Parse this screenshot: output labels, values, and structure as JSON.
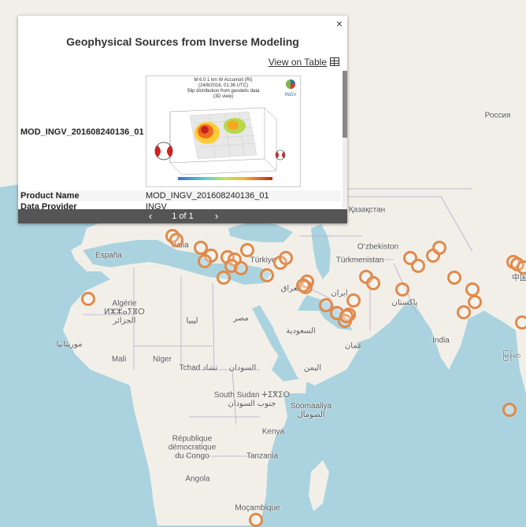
{
  "popup": {
    "title": "Geophysical Sources from Inverse Modeling",
    "close_label": "×",
    "view_table_label": "View on Table",
    "feature_id": "MOD_INGV_201608240136_01",
    "thumbnail": {
      "caption_lines": [
        "M 6.0 1 km W Accumoli (RI)",
        "(24/8/2016, 01:36 UTC)",
        "Slip distribution from geodetic data",
        "(3D view)"
      ],
      "brand": "INGV"
    },
    "attributes": [
      {
        "key": "Product Name",
        "value": "MOD_INGV_201608240136_01"
      },
      {
        "key": "Data Provider",
        "value": "INGV"
      }
    ],
    "pager": {
      "prev": "‹",
      "text": "1 of 1",
      "next": "›"
    }
  },
  "map_labels": {
    "russia": "Россия",
    "kazakhstan": "Қазақстан",
    "uzbekistan": "O‘zbekiston",
    "turkmenistan": "Türkmenistan",
    "turkey": "Türkiye",
    "italy": "Italia",
    "spain": "España",
    "algeria": "Algérie\nⵍⵣⵣⴰⵢⴻⵔ\nالجزائر",
    "morocco": "موريتانيا",
    "libya": "ليبيا",
    "egypt": "مصر",
    "iraq": "العراق",
    "iran": "ایران",
    "pakistan": "پاکستان",
    "india": "India",
    "china": "中国",
    "saudi": "السعودية",
    "oman": "عمان",
    "yemen": "اليمن",
    "mali": "Mali",
    "niger": "Niger",
    "chad": "Tchad تشاد",
    "sudan": "السودان",
    "south_sudan": "South Sudan ⵜⵉⴳⵉⵔ\nجنوب السودان",
    "somalia": "Soomaaliya\nالصومال",
    "kenya": "Kenya",
    "drc": "République\ndémocratique\ndu Congo",
    "tanzania": "Tanzania",
    "angola": "Angola",
    "mozambique": "Moçambique",
    "myanmar": "မြန်မာ"
  },
  "colors": {
    "sea": "#aad3df",
    "land": "#f2efe9",
    "marker": "#e08a4a",
    "border": "#b9a9c9"
  },
  "marker_count": 41
}
